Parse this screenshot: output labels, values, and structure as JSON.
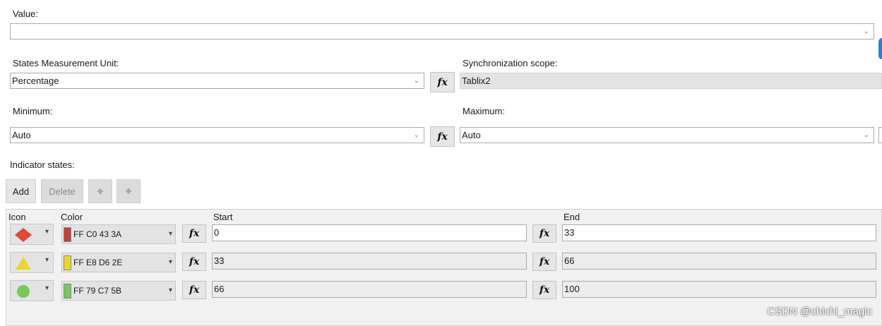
{
  "value": {
    "label": "Value:",
    "selected": ""
  },
  "states_measurement_unit": {
    "label": "States Measurement Unit:",
    "selected": "Percentage"
  },
  "synchronization_scope": {
    "label": "Synchronization scope:",
    "value": "Tablix2"
  },
  "minimum": {
    "label": "Minimum:",
    "selected": "Auto"
  },
  "maximum": {
    "label": "Maximum:",
    "selected": "Auto"
  },
  "indicator_states": {
    "label": "Indicator states:",
    "buttons": {
      "add": "Add",
      "delete": "Delete",
      "move_up_icon": "arrow-up-icon",
      "move_down_icon": "arrow-down-icon"
    },
    "columns": {
      "icon": "Icon",
      "color": "Color",
      "start": "Start",
      "end": "End"
    },
    "rows": [
      {
        "icon": "diamond-icon",
        "icon_color": "#e04a3a",
        "color_value": "FF C0 43 3A",
        "swatch": "#c0433a",
        "start": "0",
        "end": "33"
      },
      {
        "icon": "triangle-icon",
        "icon_color": "#e8d62e",
        "color_value": "FF E8 D6 2E",
        "swatch": "#e8d62e",
        "start": "33",
        "end": "66"
      },
      {
        "icon": "circle-icon",
        "icon_color": "#79c75b",
        "color_value": "FF 79 C7 5B",
        "swatch": "#79c75b",
        "start": "66",
        "end": "100"
      }
    ]
  },
  "fx_label": "fx",
  "watermark": "CSDN @chichi_magic"
}
